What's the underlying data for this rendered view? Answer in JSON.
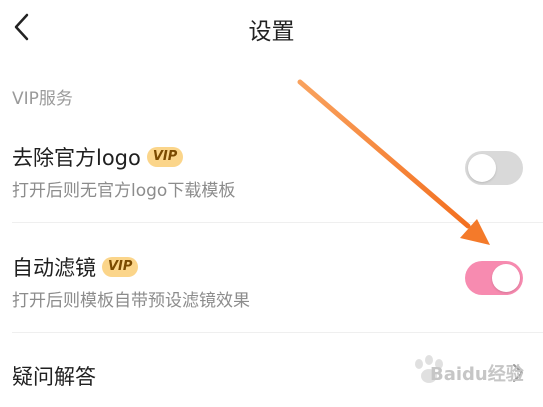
{
  "header": {
    "title": "设置"
  },
  "section": {
    "label": "VIP服务"
  },
  "settings": [
    {
      "title": "去除官方logo",
      "badge": "VIP",
      "subtitle": "打开后则无官方logo下载模板",
      "enabled": false
    },
    {
      "title": "自动滤镜",
      "badge": "VIP",
      "subtitle": "打开后则模板自带预设滤镜效果",
      "enabled": true
    }
  ],
  "faq": {
    "label": "疑问解答"
  },
  "colors": {
    "toggle_on": "#f78bb0",
    "toggle_off": "#d9d9d9",
    "vip_badge": "#fbd58a",
    "annotation_arrow": "#f47a2a"
  },
  "icons": {
    "back": "back-chevron-icon",
    "next": "chevron-right-icon"
  },
  "watermark": {
    "text": "Baidu经验"
  }
}
